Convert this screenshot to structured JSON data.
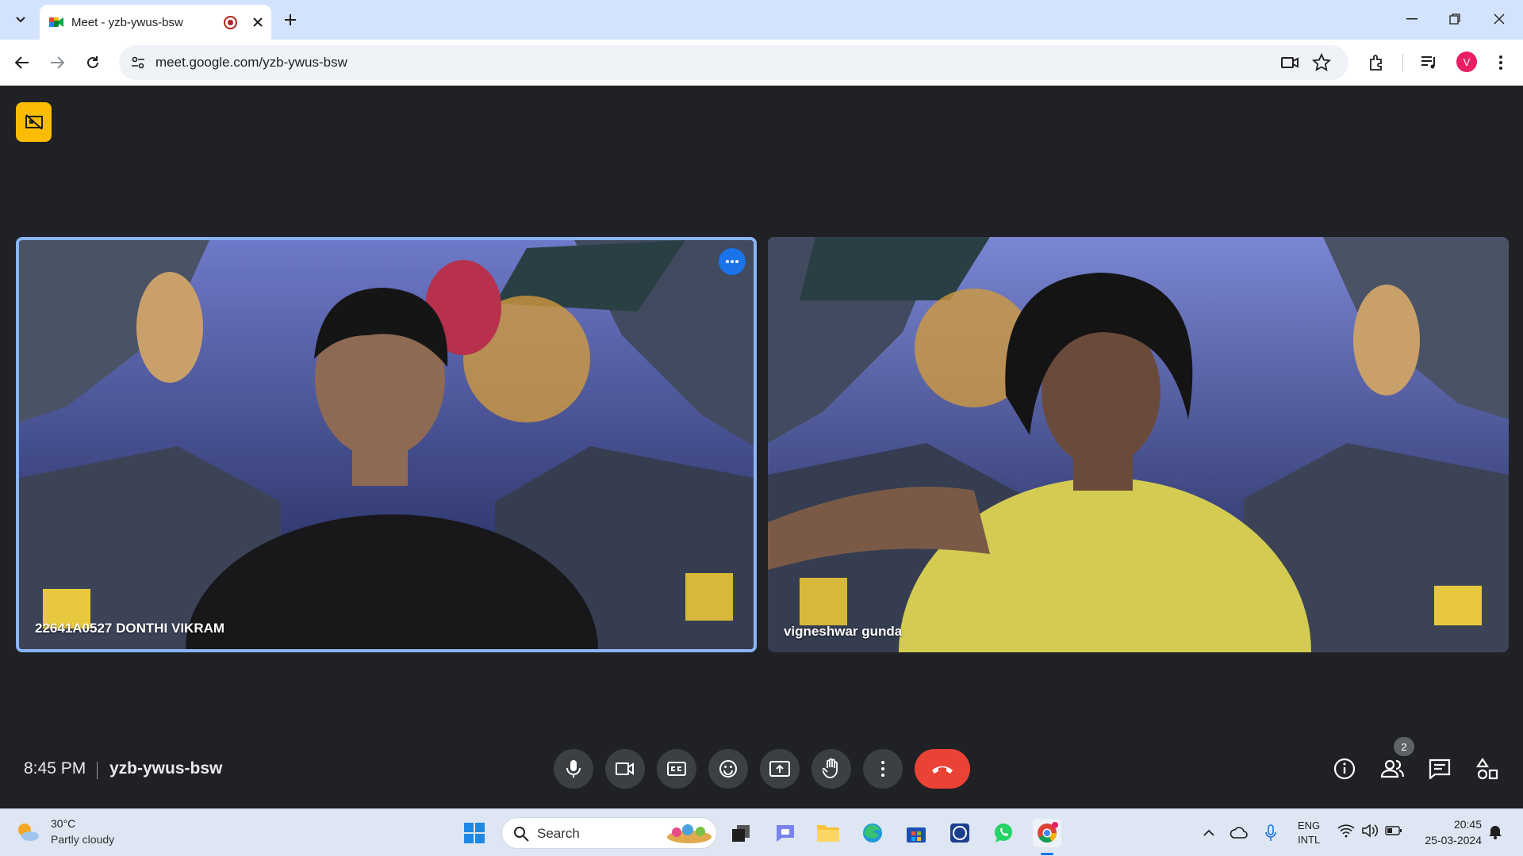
{
  "browser": {
    "tab_title": "Meet - yzb-ywus-bsw",
    "url": "meet.google.com/yzb-ywus-bsw",
    "profile_initial": "V",
    "accent": "#d3e3fd"
  },
  "meet": {
    "participants": [
      {
        "name": "22641A0527 DONTHI VIKRAM",
        "active_speaker": true
      },
      {
        "name": "vigneshwar gunda",
        "active_speaker": false
      }
    ],
    "clock": "8:45 PM",
    "meeting_code": "yzb-ywus-bsw",
    "people_count": "2",
    "leave_color": "#ea4335",
    "controls": [
      "mic-icon",
      "camera-icon",
      "captions-icon",
      "emoji-icon",
      "present-icon",
      "raise-hand-icon",
      "more-options-icon"
    ],
    "right_controls": [
      "info-icon",
      "people-icon",
      "chat-icon",
      "activities-icon"
    ]
  },
  "taskbar": {
    "weather_temp": "30°C",
    "weather_desc": "Partly cloudy",
    "search_label": "Search",
    "lang_line1": "ENG",
    "lang_line2": "INTL",
    "time": "20:45",
    "date": "25-03-2024"
  }
}
